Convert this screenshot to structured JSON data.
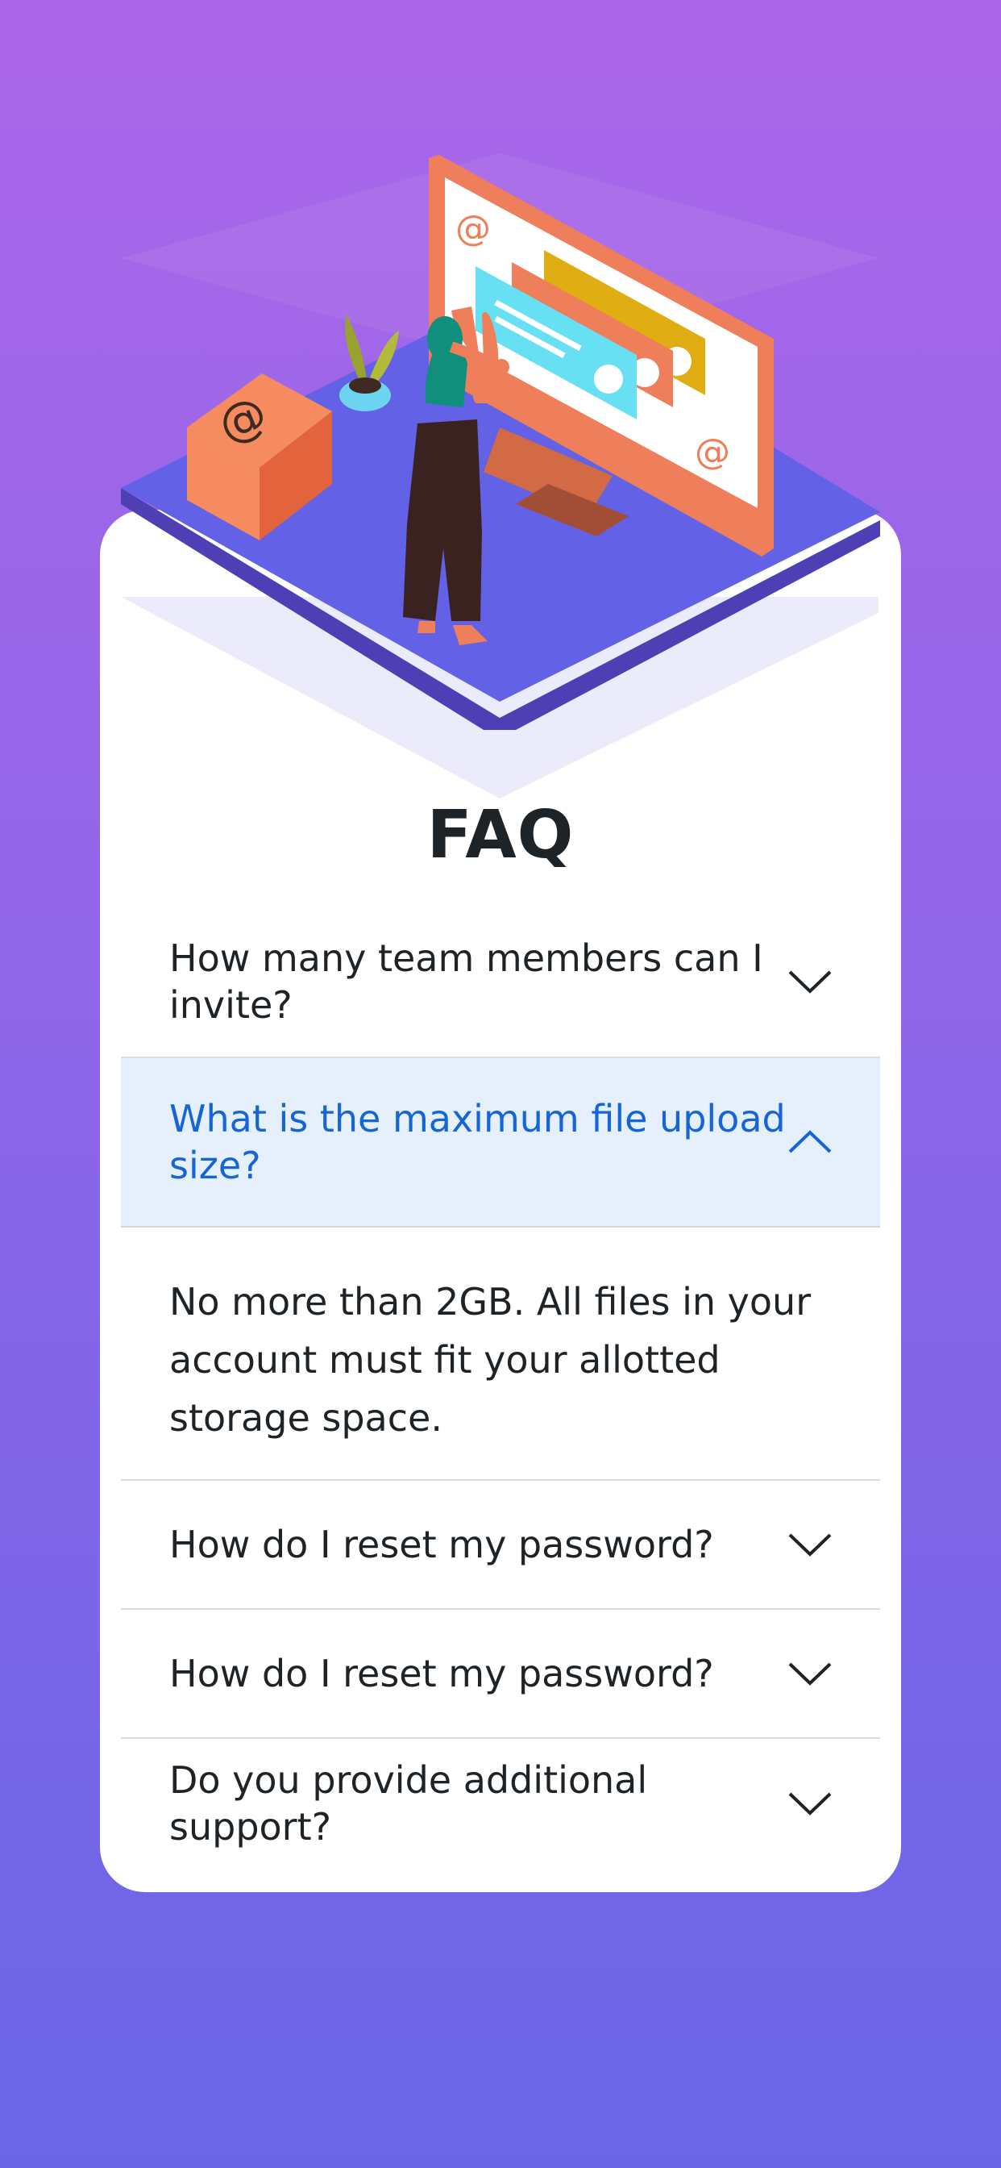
{
  "page": {
    "title": "FAQ"
  },
  "colors": {
    "background_top": "#ab66e9",
    "background_bottom": "#6966e6",
    "card": "#ffffff",
    "question_text": "#1e2327",
    "active_question_text": "#1565d6",
    "active_question_bg": "#e6f0fd",
    "divider": "#dcdcdc"
  },
  "illustration": {
    "icon": "email-workspace-illustration",
    "monitor_at_sign": "@",
    "box_at_sign": "@"
  },
  "faq": {
    "items": [
      {
        "question": "How many team members can I invite?",
        "expanded": false,
        "icon": "chevron-down-icon"
      },
      {
        "question": "What is the maximum file upload size?",
        "answer": "No more than 2GB. All files in your account must fit your allotted storage space.",
        "expanded": true,
        "icon": "chevron-up-icon"
      },
      {
        "question": "How do I reset my password?",
        "expanded": false,
        "icon": "chevron-down-icon"
      },
      {
        "question": "How do I reset my password?",
        "expanded": false,
        "icon": "chevron-down-icon"
      },
      {
        "question": "Do you provide additional support?",
        "expanded": false,
        "icon": "chevron-down-icon"
      }
    ]
  }
}
